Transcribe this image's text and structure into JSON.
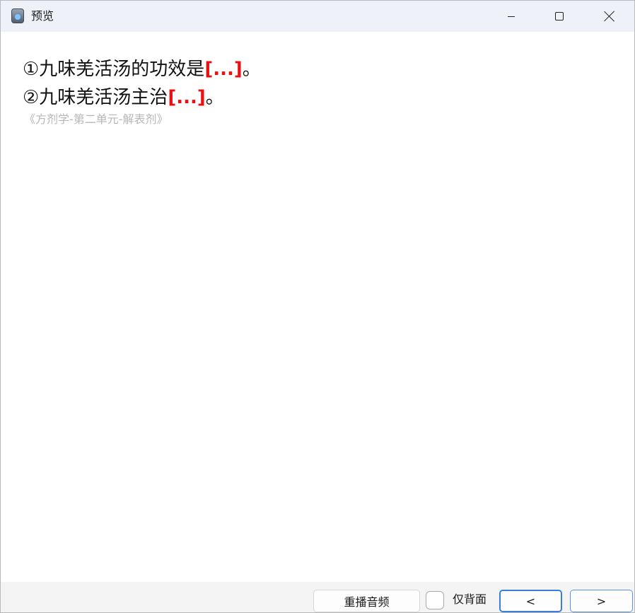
{
  "window": {
    "title": "预览",
    "icon": "app-icon"
  },
  "window_controls": {
    "minimize_icon": "minimize-icon",
    "maximize_icon": "maximize-icon",
    "close_icon": "close-icon"
  },
  "card": {
    "line1_text": "①九味羌活汤的功效是",
    "line1_cloze": "[...]",
    "line1_end": "。",
    "line2_text": "②九味羌活汤主治",
    "line2_cloze": "[...]",
    "line2_end": "。",
    "source": "《方剂学-第二单元-解表剂》",
    "cloze_color": "#e81010"
  },
  "toolbar": {
    "replay_label": "重播音频",
    "back_only_label": "仅背面",
    "back_only_checked": false,
    "prev_label": "<",
    "next_label": ">"
  }
}
